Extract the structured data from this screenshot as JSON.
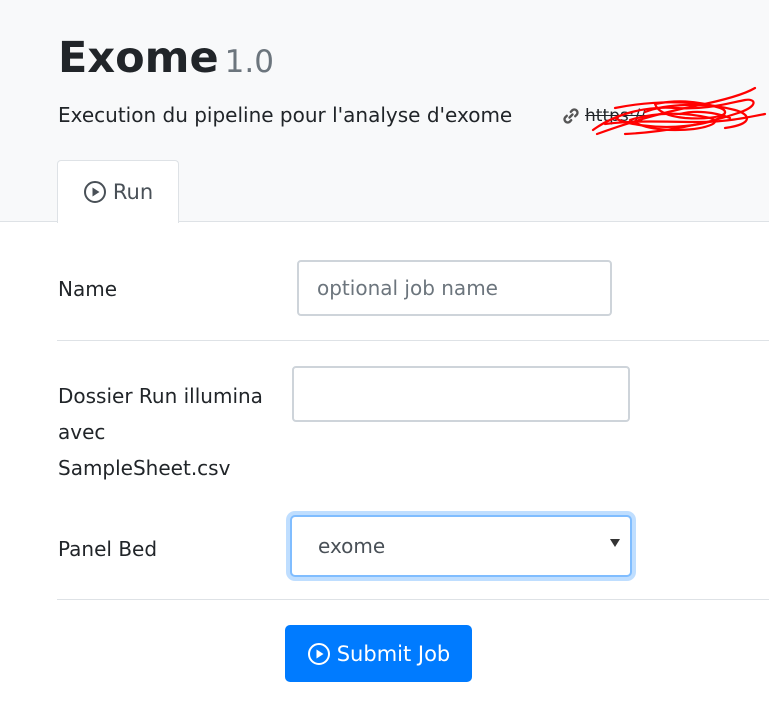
{
  "header": {
    "title": "Exome",
    "version": "1.0",
    "subtitle": "Execution du pipeline pour l'analyse d'exome",
    "link_text": "https://",
    "link_icon": "link-icon"
  },
  "tabs": [
    {
      "label": "Run",
      "icon": "play-circle-icon",
      "active": true
    }
  ],
  "form": {
    "name_label": "Name",
    "name_value": "",
    "name_placeholder": "optional job name",
    "dossier_label_line1": "Dossier Run illumina",
    "dossier_label_line2": "avec",
    "dossier_label_line3": "SampleSheet.csv",
    "dossier_value": "",
    "panel_label": "Panel Bed",
    "panel_selected": "exome"
  },
  "actions": {
    "submit_label": "Submit Job",
    "submit_icon": "play-circle-icon"
  },
  "colors": {
    "accent": "#007bff",
    "header_bg": "#f8f9fa",
    "border": "#dee2e6",
    "focus": "#80bdff",
    "redaction": "#ff0000"
  }
}
